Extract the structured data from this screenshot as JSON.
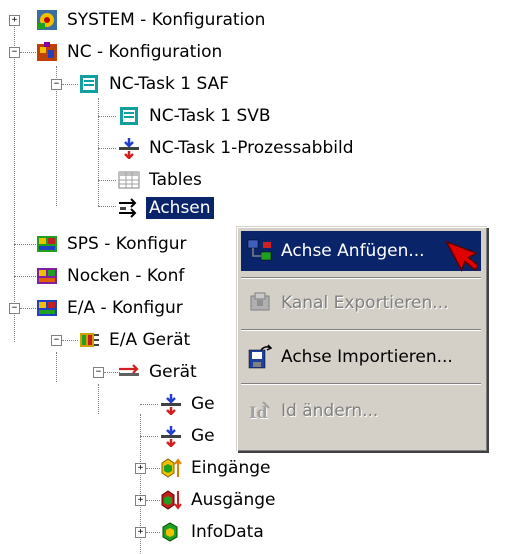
{
  "tree": {
    "items": [
      {
        "label": "SYSTEM - Konfiguration",
        "expander": "+",
        "selected": false
      },
      {
        "label": "NC - Konfiguration",
        "expander": "−",
        "selected": false
      },
      {
        "label": "NC-Task 1 SAF",
        "expander": "−",
        "selected": false
      },
      {
        "label": "NC-Task 1 SVB",
        "expander": "",
        "selected": false
      },
      {
        "label": "NC-Task 1-Prozessabbild",
        "expander": "",
        "selected": false
      },
      {
        "label": "Tables",
        "expander": "",
        "selected": false
      },
      {
        "label": "Achsen",
        "expander": "",
        "selected": true
      },
      {
        "label": "SPS - Konfigur",
        "expander": "",
        "selected": false
      },
      {
        "label": "Nocken - Konf",
        "expander": "",
        "selected": false
      },
      {
        "label": "E/A - Konfigur",
        "expander": "−",
        "selected": false
      },
      {
        "label": "E/A Gerät",
        "expander": "−",
        "selected": false
      },
      {
        "label": "Gerät",
        "expander": "−",
        "selected": false
      },
      {
        "label": "Ge",
        "expander": "",
        "selected": false
      },
      {
        "label": "Ge",
        "expander": "",
        "selected": false
      },
      {
        "label": "Eingänge",
        "expander": "+",
        "selected": false
      },
      {
        "label": "Ausgänge",
        "expander": "+",
        "selected": false
      },
      {
        "label": "InfoData",
        "expander": "+",
        "selected": false
      }
    ]
  },
  "context_menu": {
    "items": [
      {
        "label": "Achse Anfügen...",
        "enabled": true,
        "highlighted": true,
        "icon": "add-axis-icon"
      },
      {
        "label": "Kanal Exportieren...",
        "enabled": false,
        "highlighted": false,
        "icon": "export-channel-icon"
      },
      {
        "label": "Achse Importieren...",
        "enabled": true,
        "highlighted": false,
        "icon": "import-axis-icon"
      },
      {
        "label": "Id ändern...",
        "enabled": false,
        "highlighted": false,
        "icon": "change-id-icon"
      }
    ]
  },
  "colors": {
    "selection": "#0a246a",
    "menu_bg": "#d4d0c8",
    "cursor": "#e00000"
  }
}
